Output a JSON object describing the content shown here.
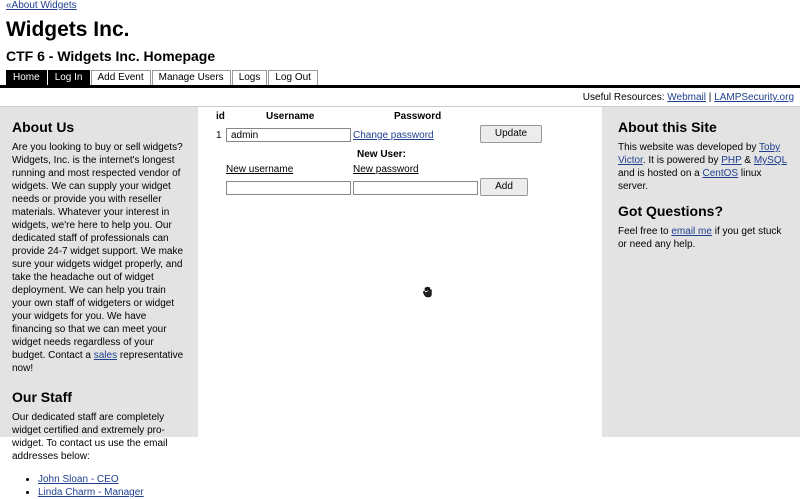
{
  "header": {
    "back_link": "«About Widgets",
    "title": "Widgets Inc.",
    "subtitle": "CTF 6 - Widgets Inc. Homepage"
  },
  "nav": {
    "tabs": [
      "Home",
      "Log In",
      "Add Event",
      "Manage Users",
      "Logs",
      "Log Out"
    ]
  },
  "resources": {
    "label": "Useful Resources:",
    "link1": "Webmail",
    "sep": " | ",
    "link2": "LAMPSecurity.org"
  },
  "left": {
    "about_title": "About Us",
    "about_text_before": "Are you looking to buy or sell widgets? Widgets, Inc. is the internet's longest running and most respected vendor of widgets. We can supply your widget needs or provide you with reseller materials. Whatever your interest in widgets, we're here to help you. Our dedicated staff of professionals can provide 24-7 widget support. We make sure your widgets widget properly, and take the headache out of widget deployment. We can help you train your own staff of widgeters or widget your widgets for you. We have financing so that we can meet your widget needs regardless of your budget. Contact a ",
    "about_link": "sales",
    "about_text_after": " representative now!",
    "staff_title": "Our Staff",
    "staff_text": "Our dedicated staff are completely widget certified and extremely pro-widget. To contact us use the email addresses below:",
    "staff": [
      "John Sloan - CEO",
      "Linda Charm - Manager"
    ]
  },
  "main": {
    "col_id": "id",
    "col_username": "Username",
    "col_password": "Password",
    "row_id": "1",
    "row_username": "admin",
    "change_password": "Change password",
    "update_label": "Update",
    "new_user_title": "New User:",
    "new_username_label": "New username",
    "new_password_label": "New password",
    "add_label": "Add"
  },
  "right": {
    "about_title": "About this Site",
    "dev_before": "This website was developed by ",
    "dev_link": "Toby Victor",
    "dev_mid1": ". It is powered by ",
    "php": "PHP",
    "amp": " & ",
    "mysql": "MySQL",
    "dev_mid2": " and is hosted on a ",
    "centos": "CentOS",
    "dev_after": " linux server.",
    "questions_title": "Got Questions?",
    "q_before": "Feel free to ",
    "q_link": "email me",
    "q_after": " if you get stuck or need any help."
  }
}
